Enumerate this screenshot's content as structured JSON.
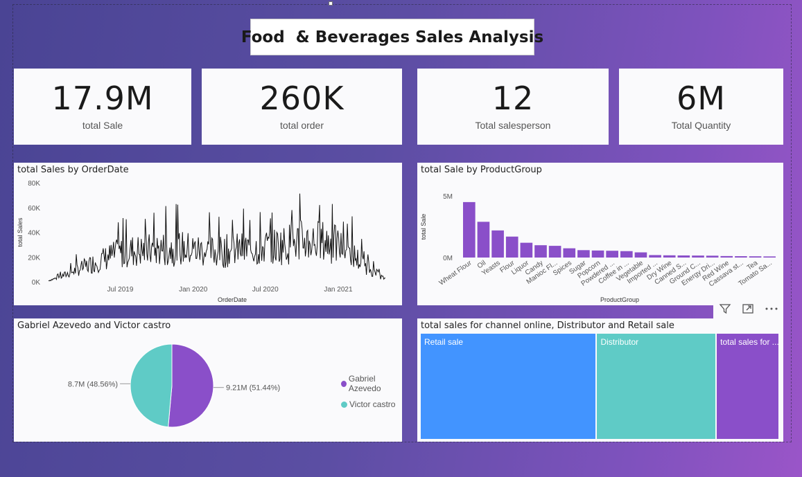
{
  "title": "Food  & Beverages Sales Analysis",
  "kpis": [
    {
      "value": "17.9M",
      "label": "total Sale"
    },
    {
      "value": "260K",
      "label": "total order"
    },
    {
      "value": "12",
      "label": "Total salesperson"
    },
    {
      "value": "6M",
      "label": "Total Quantity"
    }
  ],
  "colors": {
    "purple": "#8a4fc9",
    "teal": "#5fcbc6",
    "blue": "#4294ff",
    "line": "#111111"
  },
  "icons": [
    "filter-icon",
    "focus-mode-icon",
    "more-options-icon"
  ],
  "chart_data": [
    {
      "type": "line",
      "title": "total Sales by OrderDate",
      "xlabel": "OrderDate",
      "ylabel": "total Sales",
      "x_ticks": [
        "Jul 2019",
        "Jan 2020",
        "Jul 2020",
        "Jan 2021"
      ],
      "y_ticks": [
        "0K",
        "20K",
        "40K",
        "60K",
        "80K"
      ],
      "ylim": [
        0,
        80000
      ],
      "xlim": [
        "2019-01-01",
        "2021-04-30"
      ],
      "series": [
        {
          "x": [
            "2019-01-01",
            "2019-02-01",
            "2019-03-01",
            "2019-04-01",
            "2019-05-01",
            "2019-06-01",
            "2019-07-01",
            "2019-08-01",
            "2019-09-01",
            "2019-10-01",
            "2019-11-01",
            "2019-12-01",
            "2020-01-01",
            "2020-02-01",
            "2020-03-01",
            "2020-04-01",
            "2020-05-01",
            "2020-06-01",
            "2020-07-01",
            "2020-08-01",
            "2020-09-01",
            "2020-10-01",
            "2020-11-01",
            "2020-12-01",
            "2021-01-01",
            "2021-02-01",
            "2021-03-01",
            "2021-04-01",
            "2021-04-30"
          ],
          "y": [
            1000,
            4000,
            8000,
            12000,
            16000,
            20000,
            23000,
            25000,
            25000,
            26000,
            27000,
            27000,
            26000,
            25000,
            24000,
            25000,
            26000,
            27000,
            28000,
            29000,
            31000,
            33000,
            33000,
            32000,
            29000,
            24000,
            15000,
            8000,
            2000
          ]
        }
      ]
    },
    {
      "type": "bar",
      "title": "total Sale by ProductGroup",
      "xlabel": "ProductGroup",
      "ylabel": "total Sale",
      "y_ticks": [
        "0M",
        "5M"
      ],
      "ylim": [
        0,
        6000000
      ],
      "categories": [
        "Wheat Flour",
        "Oil",
        "Yeasts",
        "Flour",
        "Liquor",
        "Candy",
        "Manioc Fl...",
        "Spices",
        "Sugar",
        "Popcorn",
        "Powdered ...",
        "Coffee in ...",
        "Vegetable",
        "Imported ...",
        "Dry Wine",
        "Canned S...",
        "Ground C...",
        "Energy Dri...",
        "Red Wine",
        "Cassava st...",
        "Tea",
        "Tomato Sa..."
      ],
      "values": [
        4500000,
        2900000,
        2200000,
        1700000,
        1200000,
        1000000,
        950000,
        750000,
        600000,
        570000,
        550000,
        520000,
        420000,
        200000,
        180000,
        170000,
        160000,
        150000,
        120000,
        110000,
        100000,
        90000
      ]
    },
    {
      "type": "pie",
      "title": "Gabriel Azevedo and Victor castro",
      "categories": [
        "Gabriel Azevedo",
        "Victor castro"
      ],
      "values": [
        9210000,
        8700000
      ],
      "data_labels": [
        "9.21M (51.44%)",
        "8.7M (48.56%)"
      ]
    },
    {
      "type": "treemap",
      "title": "total sales for channel online, Distributor and Retail sale",
      "categories": [
        "Retail sale",
        "Distributor",
        "total sales for ..."
      ],
      "values": [
        8400000,
        5700000,
        3000000
      ]
    }
  ]
}
